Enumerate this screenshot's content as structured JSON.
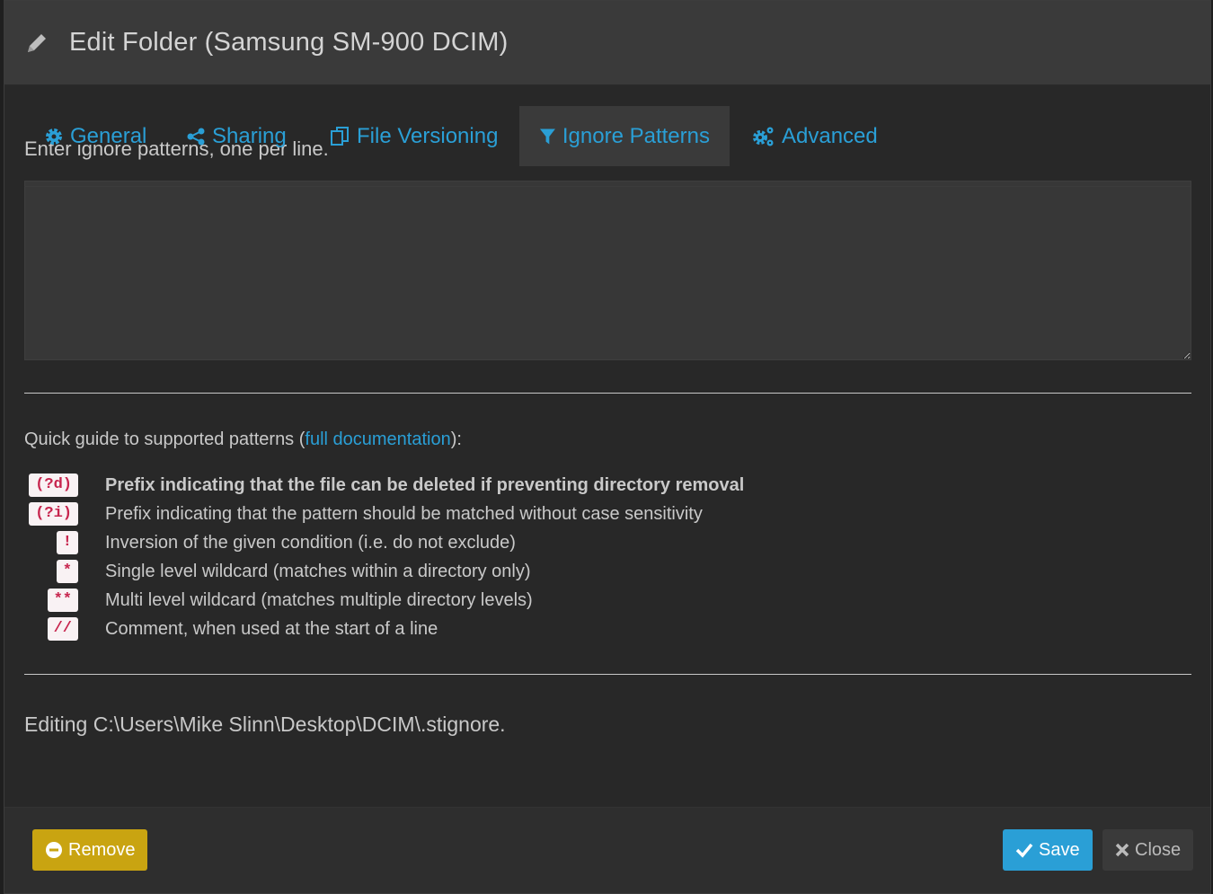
{
  "dialog": {
    "title": "Edit Folder (Samsung SM-900 DCIM)",
    "icon": "pencil-icon"
  },
  "tabs": [
    {
      "label": "General",
      "icon": "gear-icon",
      "active": false
    },
    {
      "label": "Sharing",
      "icon": "share-icon",
      "active": false
    },
    {
      "label": "File Versioning",
      "icon": "copy-icon",
      "active": false
    },
    {
      "label": "Ignore Patterns",
      "icon": "filter-icon",
      "active": true
    },
    {
      "label": "Advanced",
      "icon": "cogs-icon",
      "active": false
    }
  ],
  "ignore": {
    "hint": "Enter ignore patterns, one per line.",
    "patterns_value": ""
  },
  "guide": {
    "prefix": "Quick guide to supported patterns (",
    "link_text": "full documentation",
    "suffix": "):",
    "items": [
      {
        "code": "(?d)",
        "description": "Prefix indicating that the file can be deleted if preventing directory removal",
        "bold": true
      },
      {
        "code": "(?i)",
        "description": "Prefix indicating that the pattern should be matched without case sensitivity",
        "bold": false
      },
      {
        "code": "!",
        "description": "Inversion of the given condition (i.e. do not exclude)",
        "bold": false
      },
      {
        "code": "*",
        "description": "Single level wildcard (matches within a directory only)",
        "bold": false
      },
      {
        "code": "**",
        "description": "Multi level wildcard (matches multiple directory levels)",
        "bold": false
      },
      {
        "code": "//",
        "description": "Comment, when used at the start of a line",
        "bold": false
      }
    ]
  },
  "editing_text": "Editing C:\\Users\\Mike Slinn\\Desktop\\DCIM\\.stignore.",
  "footer": {
    "remove_label": "Remove",
    "save_label": "Save",
    "close_label": "Close"
  },
  "colors": {
    "accent": "#2a9fd6",
    "warning": "#c9a411",
    "code_text": "#c7254e",
    "code_bg": "#f9f2f4"
  }
}
